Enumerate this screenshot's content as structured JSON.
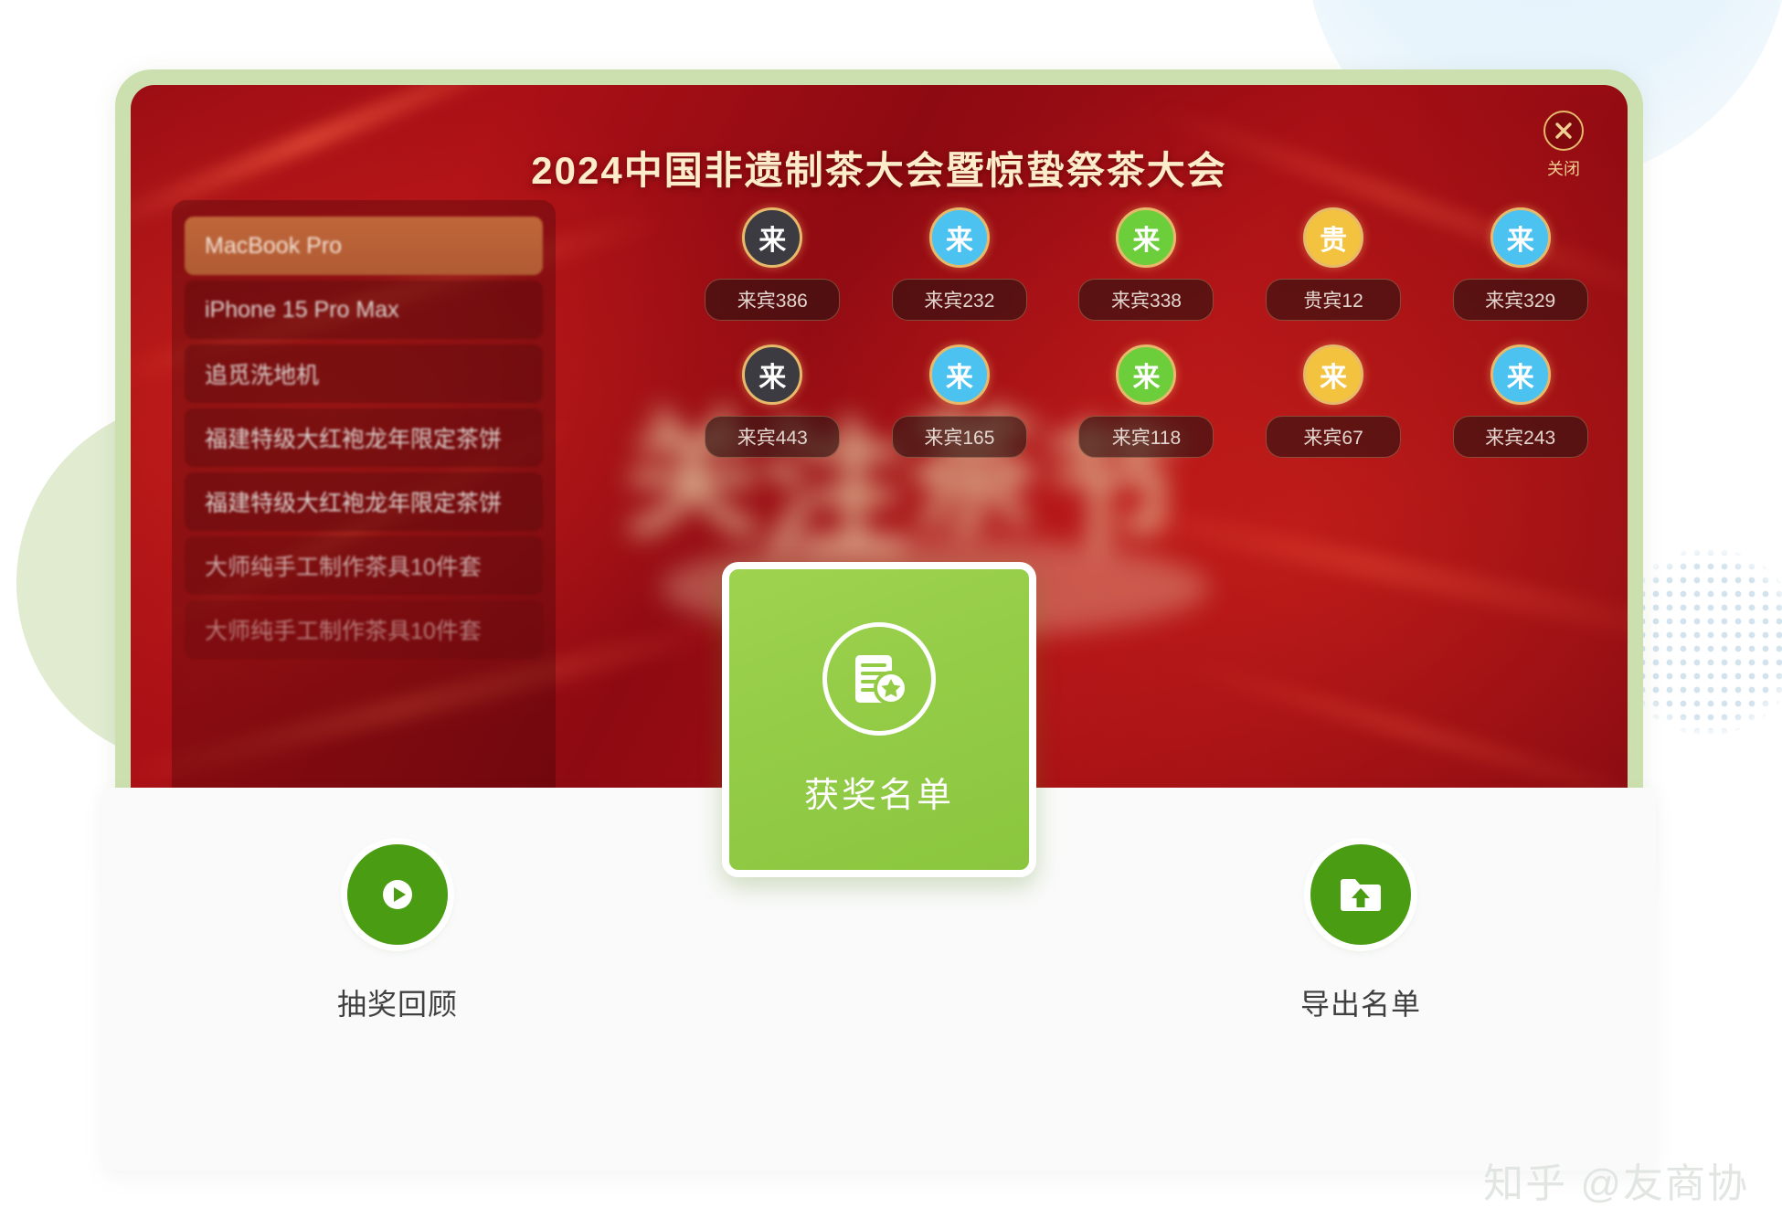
{
  "banner": {
    "title": "2024中国非遗制茶大会暨惊蛰祭茶大会",
    "close_label": "关闭",
    "close_icon": "close-x-icon"
  },
  "prize_list": {
    "items": [
      {
        "label": "MacBook Pro",
        "state": "active"
      },
      {
        "label": "iPhone 15 Pro Max",
        "state": "normal"
      },
      {
        "label": "追觅洗地机",
        "state": "normal"
      },
      {
        "label": "福建特级大红袍龙年限定茶饼",
        "state": "normal"
      },
      {
        "label": "福建特级大红袍龙年限定茶饼",
        "state": "normal"
      },
      {
        "label": "大师纯手工制作茶具10件套",
        "state": "dim"
      },
      {
        "label": "大师纯手工制作茶具10件套",
        "state": "dim2"
      }
    ]
  },
  "guests": {
    "rows": [
      [
        {
          "avatar_text": "来",
          "tag": "来宾386",
          "color": "#3b3b41"
        },
        {
          "avatar_text": "来",
          "tag": "来宾232",
          "color": "#4cc2f1"
        },
        {
          "avatar_text": "来",
          "tag": "来宾338",
          "color": "#6dce3b"
        },
        {
          "avatar_text": "贵",
          "tag": "贵宾12",
          "color": "#f3c23f"
        },
        {
          "avatar_text": "来",
          "tag": "来宾329",
          "color": "#4cc2f1"
        }
      ],
      [
        {
          "avatar_text": "来",
          "tag": "来宾443",
          "color": "#3b3b41"
        },
        {
          "avatar_text": "来",
          "tag": "来宾165",
          "color": "#4cc2f1"
        },
        {
          "avatar_text": "来",
          "tag": "来宾118",
          "color": "#6dce3b"
        },
        {
          "avatar_text": "来",
          "tag": "来宾67",
          "color": "#f3c23f"
        },
        {
          "avatar_text": "来",
          "tag": "来宾243",
          "color": "#4cc2f1"
        }
      ]
    ]
  },
  "actions": {
    "replay": {
      "label": "抽奖回顾",
      "icon": "play-circle-icon"
    },
    "winners": {
      "label": "获奖名单",
      "icon": "list-star-badge-icon"
    },
    "export": {
      "label": "导出名单",
      "icon": "folder-upload-icon"
    }
  },
  "watermark": {
    "text": "知乎 @友商协"
  },
  "colors": {
    "brand_green": "#8bc63f",
    "button_green": "#4a9c12",
    "frame_green": "#cbe0ae",
    "banner_red": "#9c0e14",
    "gold": "#e7b96a",
    "title_cream": "#fdecc9"
  }
}
